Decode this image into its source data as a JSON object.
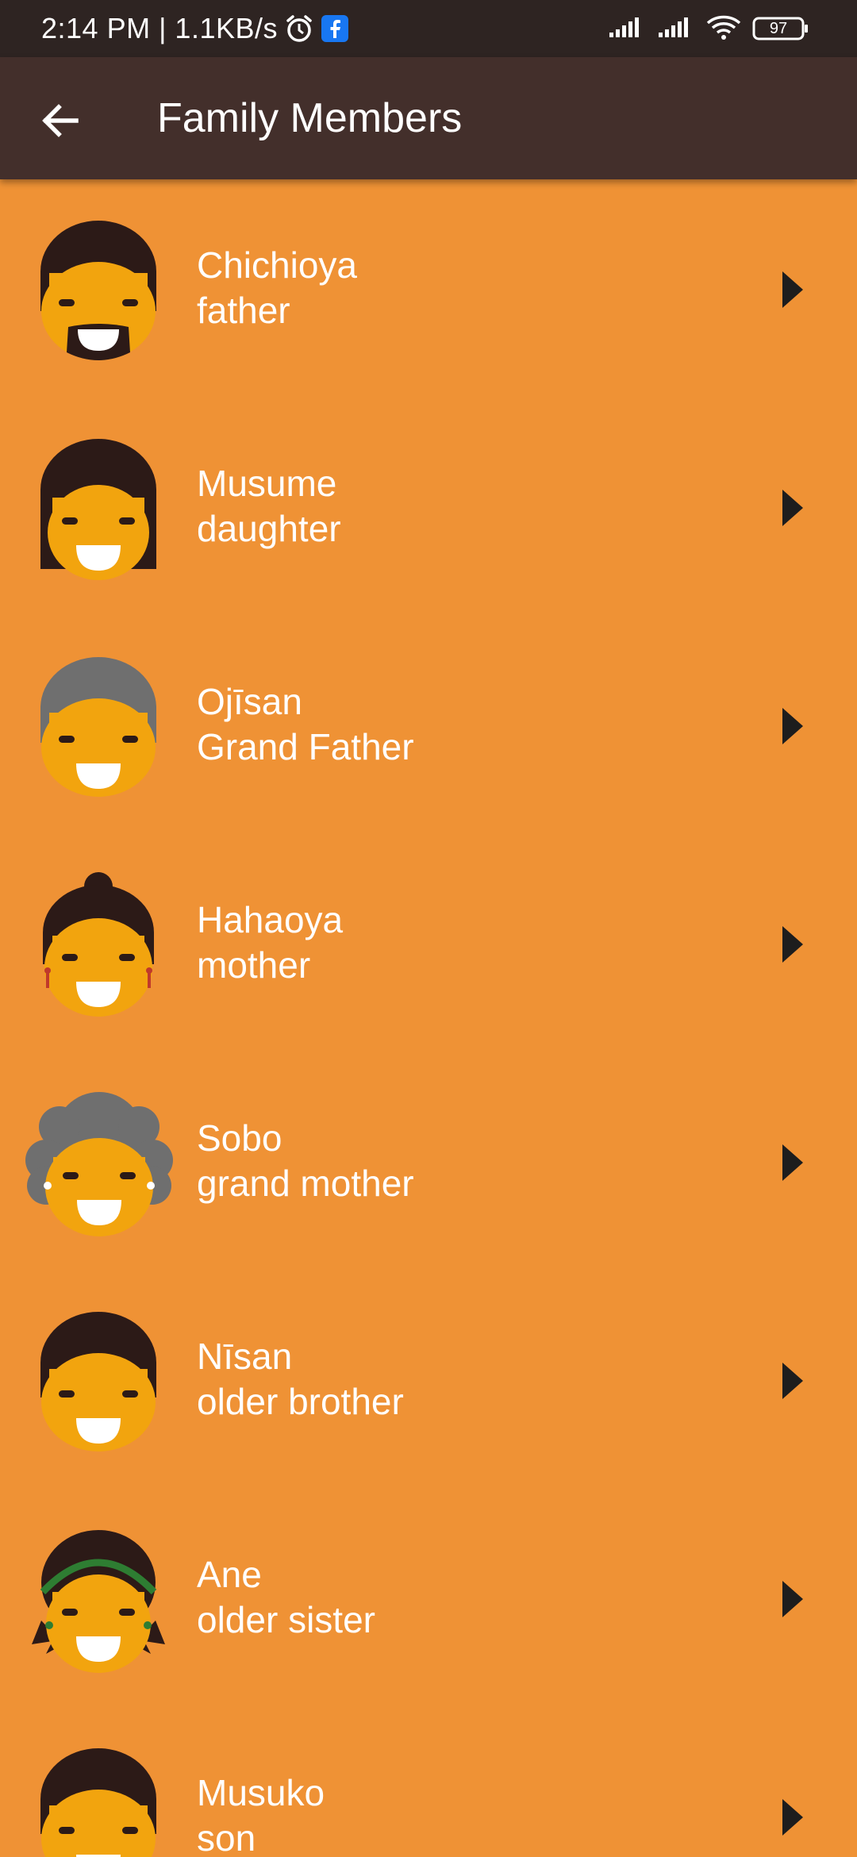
{
  "status_bar": {
    "time_text": "2:14 PM | 1.1KB/s",
    "battery": "97",
    "icons": [
      "alarm-icon",
      "facebook-icon",
      "signal-icon",
      "signal-icon",
      "wifi-icon",
      "battery-icon"
    ]
  },
  "app_bar": {
    "title": "Family Members",
    "back_icon": "arrow-left-icon"
  },
  "members": [
    {
      "name": "Chichioya",
      "translation": "father",
      "avatar": "father-face"
    },
    {
      "name": "Musume",
      "translation": "daughter",
      "avatar": "daughter-face"
    },
    {
      "name": "Ojīsan",
      "translation": "Grand Father",
      "avatar": "grandfather-face"
    },
    {
      "name": "Hahaoya",
      "translation": "mother",
      "avatar": "mother-face"
    },
    {
      "name": "Sobo",
      "translation": "grand mother",
      "avatar": "grandmother-face"
    },
    {
      "name": "Nīsan",
      "translation": "older brother",
      "avatar": "older-brother-face"
    },
    {
      "name": "Ane",
      "translation": "older sister",
      "avatar": "older-sister-face"
    },
    {
      "name": "Musuko",
      "translation": "son",
      "avatar": "son-face"
    }
  ],
  "colors": {
    "background": "#EF9235",
    "app_bar": "#432F2B",
    "status_bar": "#2E2422",
    "face": "#F2A40E",
    "hair_dark": "#2C1A17",
    "hair_gray": "#6F6F6F",
    "text": "#FFFFFF"
  }
}
